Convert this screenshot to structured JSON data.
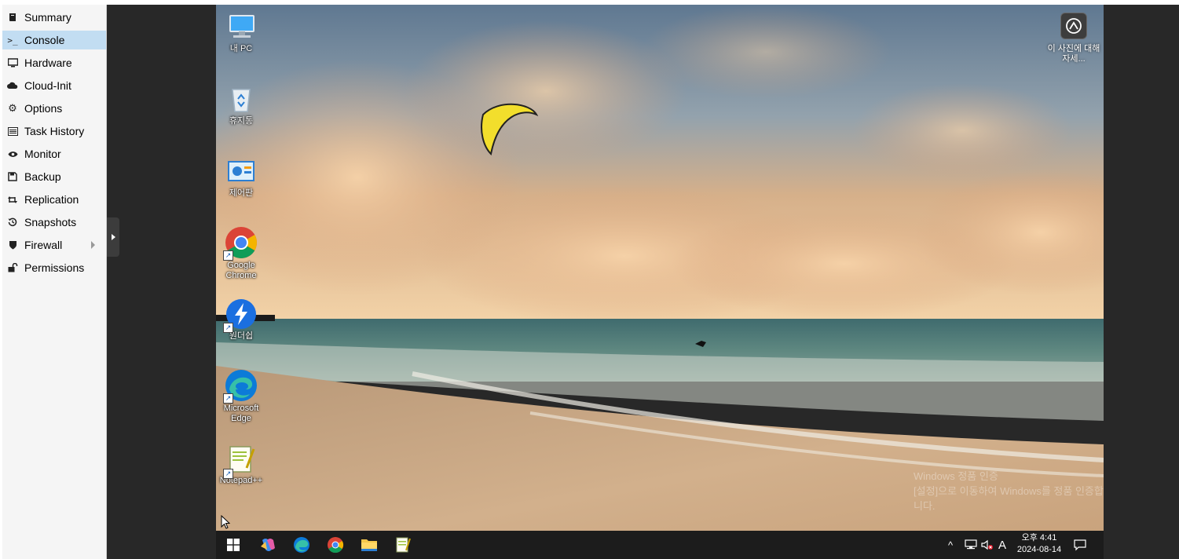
{
  "sidebar": {
    "items": [
      {
        "label": "Summary",
        "icon": "book-icon"
      },
      {
        "label": "Console",
        "icon": "terminal-icon"
      },
      {
        "label": "Hardware",
        "icon": "monitor-icon"
      },
      {
        "label": "Cloud-Init",
        "icon": "cloud-icon"
      },
      {
        "label": "Options",
        "icon": "gear-icon"
      },
      {
        "label": "Task History",
        "icon": "list-icon"
      },
      {
        "label": "Monitor",
        "icon": "eye-icon"
      },
      {
        "label": "Backup",
        "icon": "floppy-icon"
      },
      {
        "label": "Replication",
        "icon": "retweet-icon"
      },
      {
        "label": "Snapshots",
        "icon": "history-icon"
      },
      {
        "label": "Firewall",
        "icon": "shield-icon"
      },
      {
        "label": "Permissions",
        "icon": "unlock-icon"
      }
    ],
    "active": "Console",
    "active_color": "#c2ddf2"
  },
  "desktop": {
    "icons": [
      {
        "label": "내 PC"
      },
      {
        "label": "휴지통"
      },
      {
        "label": "제어판"
      },
      {
        "label": "Google Chrome"
      },
      {
        "label": "원더쉽"
      },
      {
        "label": "Microsoft Edge"
      },
      {
        "label": "Notepad++"
      }
    ],
    "spotlight_label": "이 사진에 대해 자세...",
    "watermark_line1": "Windows 정품 인증",
    "watermark_line2": "[설정]으로 이동하여 Windows를 정품 인증합니다."
  },
  "taskbar": {
    "apps": [
      "start-icon",
      "copilot-icon",
      "edge-icon",
      "chrome-icon",
      "file-explorer-icon",
      "notepadpp-icon"
    ],
    "input_indicator": "A",
    "time": "오후 4:41",
    "date": "2024-08-14",
    "background": "#1c1c1c"
  }
}
